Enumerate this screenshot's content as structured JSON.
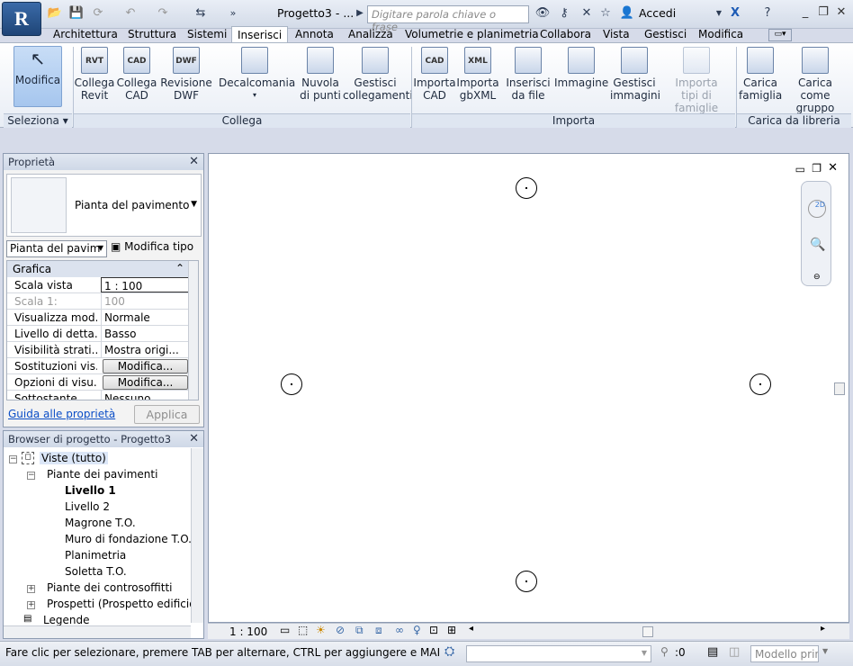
{
  "titlebar": {
    "app_letter": "R",
    "doc_title": "Progetto3 - ...",
    "search_placeholder": "Digitare parola chiave o frase",
    "signin": "Accedi",
    "more": "»"
  },
  "tabs": [
    "Architettura",
    "Struttura",
    "Sistemi",
    "Inserisci",
    "Annota",
    "Analizza",
    "Volumetrie e planimetria",
    "Collabora",
    "Vista",
    "Gestisci",
    "Modifica"
  ],
  "active_tab": "Inserisci",
  "ribbon": {
    "modifica": "Modifica",
    "collega": [
      {
        "l1": "Collega",
        "l2": "Revit",
        "icon": "RVT"
      },
      {
        "l1": "Collega",
        "l2": "CAD",
        "icon": "CAD"
      },
      {
        "l1": "Revisione",
        "l2": "DWF",
        "icon": "DWF"
      },
      {
        "l1": "Decalcomania",
        "l2": "▾",
        "icon": ""
      },
      {
        "l1": "Nuvola",
        "l2": "di punti",
        "icon": ""
      },
      {
        "l1": "Gestisci",
        "l2": "collegamenti",
        "icon": ""
      }
    ],
    "importa": [
      {
        "l1": "Importa",
        "l2": "CAD",
        "icon": "CAD"
      },
      {
        "l1": "Importa",
        "l2": "gbXML",
        "icon": "XML"
      },
      {
        "l1": "Inserisci",
        "l2": "da file",
        "icon": ""
      },
      {
        "l1": "Immagine",
        "l2": "",
        "icon": ""
      },
      {
        "l1": "Gestisci",
        "l2": "immagini",
        "icon": ""
      },
      {
        "l1": "Importa",
        "l2": "tipi di famiglie",
        "icon": ""
      }
    ],
    "libreria": [
      {
        "l1": "Carica",
        "l2": "famiglia",
        "icon": ""
      },
      {
        "l1": "Carica come",
        "l2": "gruppo",
        "icon": ""
      }
    ],
    "panels": {
      "seleziona": "Seleziona ▾",
      "collega": "Collega",
      "importa": "Importa",
      "libreria": "Carica da libreria"
    }
  },
  "properties": {
    "title": "Proprietà",
    "type_name": "Pianta del pavimento",
    "instance": "Pianta del pavim",
    "edit_type": "Modifica tipo",
    "group": "Grafica",
    "rows": [
      {
        "k": "Scala vista",
        "v": "1 : 100",
        "kind": "input"
      },
      {
        "k": "Scala  1:",
        "v": "100",
        "kind": "disabled"
      },
      {
        "k": "Visualizza mod...",
        "v": "Normale",
        "kind": "text"
      },
      {
        "k": "Livello di detta...",
        "v": "Basso",
        "kind": "text"
      },
      {
        "k": "Visibilità strati...",
        "v": "Mostra origi...",
        "kind": "text"
      },
      {
        "k": "Sostituzioni vis...",
        "v": "Modifica...",
        "kind": "button"
      },
      {
        "k": "Opzioni di visu...",
        "v": "Modifica...",
        "kind": "button"
      },
      {
        "k": "Sottostante",
        "v": "Nessuno",
        "kind": "text"
      }
    ],
    "help_link": "Guida alle proprietà",
    "apply": "Applica"
  },
  "browser": {
    "title": "Browser di progetto - Progetto3",
    "root": "Viste (tutto)",
    "floor_plans": "Piante dei pavimenti",
    "levels": [
      "Livello 1",
      "Livello 2",
      "Magrone T.O.",
      "Muro di fondazione T.O.",
      "Planimetria",
      "Soletta T.O."
    ],
    "ceiling_plans": "Piante dei controsoffitti",
    "elevations": "Prospetti (Prospetto edificio)",
    "legends": "Legende"
  },
  "view_control": {
    "scale": "1 : 100"
  },
  "status": {
    "message": "Fare clic per selezionare, premere TAB per alternare, CTRL per aggiungere e MAIUSC per des",
    "count": ":0",
    "model": "Modello princ"
  }
}
